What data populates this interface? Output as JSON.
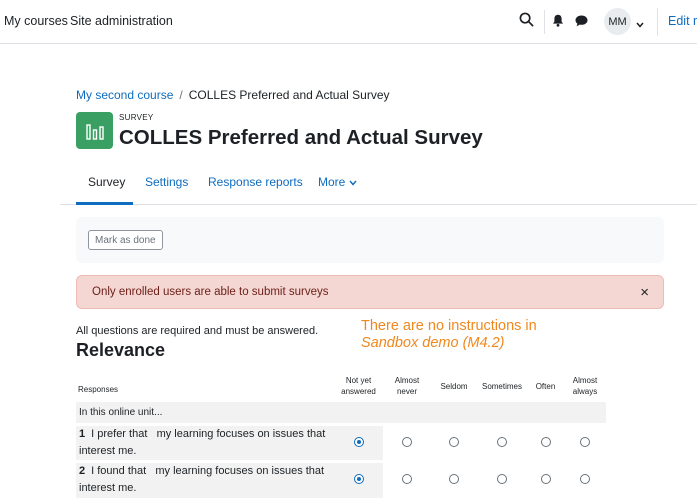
{
  "navbar": {
    "links": [
      "My courses",
      "Site administration"
    ],
    "avatar_initials": "MM",
    "edit_mode_label": "Edit m"
  },
  "breadcrumb": {
    "course": "My second course",
    "separator": "/",
    "current": "COLLES Preferred and Actual Survey"
  },
  "activity": {
    "kind": "SURVEY",
    "title": "COLLES Preferred and Actual Survey",
    "icon_color": "#399f62"
  },
  "tabs": [
    {
      "label": "Survey",
      "active": true
    },
    {
      "label": "Settings",
      "active": false
    },
    {
      "label": "Response reports",
      "active": false
    },
    {
      "label": "More",
      "active": false
    }
  ],
  "completion": {
    "mark_done_label": "Mark as done"
  },
  "alert": {
    "message": "Only enrolled users are able to submit surveys",
    "close_glyph": "×"
  },
  "required_note": "All questions are required and must be answered.",
  "annotation": {
    "line1": "There are no instructions in",
    "line2": "Sandbox demo (M4.2)"
  },
  "section_title": "Relevance",
  "table": {
    "responses_header": "Responses",
    "columns": [
      "Not yet answered",
      "Almost never",
      "Seldom",
      "Sometimes",
      "Often",
      "Almost always"
    ],
    "group_label": "In this online unit...",
    "questions": [
      {
        "number": "1",
        "prefix": "I prefer that",
        "text": "my learning focuses on issues that interest me.",
        "selected": 0
      },
      {
        "number": "2",
        "prefix": "I found that",
        "text": "my learning focuses on issues that interest me.",
        "selected": 0
      }
    ]
  },
  "colors": {
    "link": "#0f6cbf",
    "alert_bg": "#f4d6d2",
    "annotation": "#f0881e"
  }
}
